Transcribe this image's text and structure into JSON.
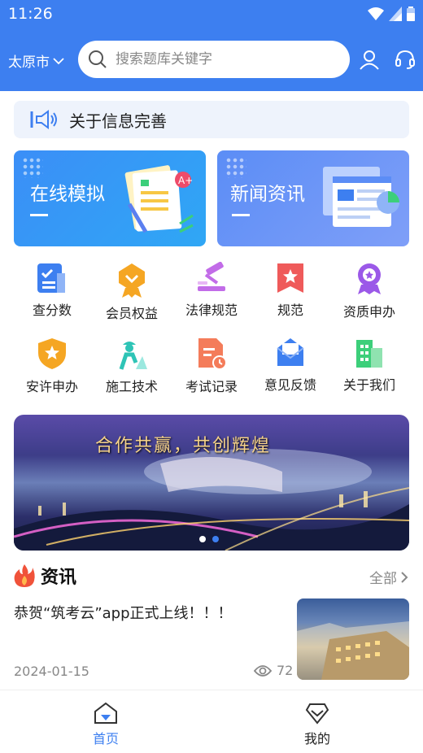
{
  "status": {
    "time": "11:26"
  },
  "header": {
    "city": "太原市",
    "search_placeholder": "搜索题库关键字"
  },
  "notice": {
    "text": "关于信息完善"
  },
  "cards": [
    {
      "title": "在线模拟"
    },
    {
      "title": "新闻资讯"
    }
  ],
  "grid": [
    {
      "label": "查分数",
      "icon": "score-icon"
    },
    {
      "label": "会员权益",
      "icon": "member-badge-icon"
    },
    {
      "label": "法律规范",
      "icon": "gavel-icon"
    },
    {
      "label": "规范",
      "icon": "bookmark-star-icon"
    },
    {
      "label": "资质申办",
      "icon": "award-icon"
    },
    {
      "label": "安许申办",
      "icon": "shield-star-icon"
    },
    {
      "label": "施工技术",
      "icon": "worker-icon"
    },
    {
      "label": "考试记录",
      "icon": "document-clock-icon"
    },
    {
      "label": "意见反馈",
      "icon": "feedback-mail-icon"
    },
    {
      "label": "关于我们",
      "icon": "building-icon"
    }
  ],
  "banner": {
    "slogan": "合作共赢，共创辉煌",
    "active_index": 1,
    "count": 2
  },
  "news_section": {
    "title": "资讯",
    "more": "全部"
  },
  "news": [
    {
      "title": "恭贺“筑考云”app正式上线！！！",
      "date": "2024-01-15",
      "views": "72"
    }
  ],
  "tabs": [
    {
      "label": "首页",
      "active": true
    },
    {
      "label": "我的",
      "active": false
    }
  ],
  "colors": {
    "primary": "#3d7ff0",
    "tab_active": "#3d7ff0"
  }
}
